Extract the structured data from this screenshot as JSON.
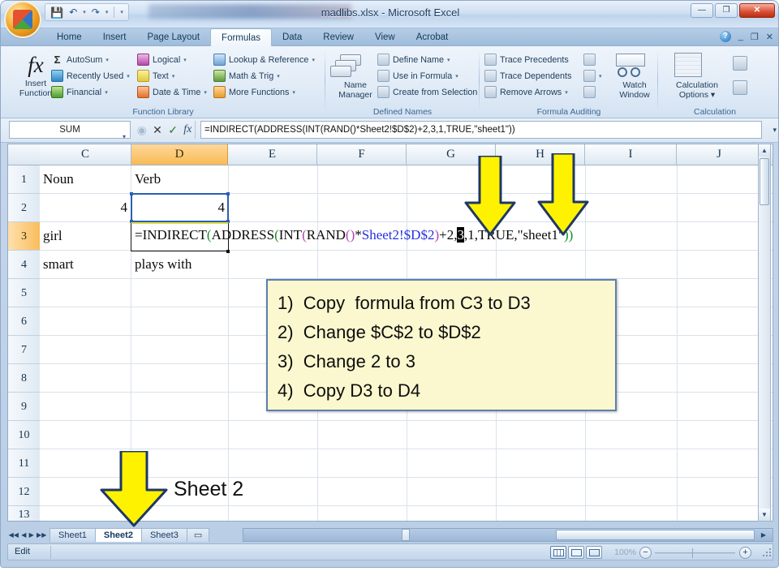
{
  "window": {
    "title": "madlibs.xlsx - Microsoft Excel",
    "minimize_label": "—",
    "restore_label": "❐",
    "close_label": "✕"
  },
  "quick_access": {
    "save_icon": "save-icon",
    "undo_icon": "undo-icon",
    "redo_icon": "redo-icon",
    "customize_icon": "chevron-down-icon"
  },
  "ribbon": {
    "tabs": [
      {
        "label": "Home",
        "active": false
      },
      {
        "label": "Insert",
        "active": false
      },
      {
        "label": "Page Layout",
        "active": false
      },
      {
        "label": "Formulas",
        "active": true
      },
      {
        "label": "Data",
        "active": false
      },
      {
        "label": "Review",
        "active": false
      },
      {
        "label": "View",
        "active": false
      },
      {
        "label": "Acrobat",
        "active": false
      }
    ],
    "help_label": "?",
    "minimize_ribbon_label": "_",
    "restore_ribbon_label": "❐",
    "close_doc_label": "✕",
    "groups": [
      {
        "title": "Function Library",
        "big_button": {
          "line1": "Insert",
          "line2": "Function",
          "icon": "fx-icon"
        },
        "items": [
          {
            "label": "AutoSum",
            "icon": "sigma-icon",
            "caret": "▾"
          },
          {
            "label": "Recently Used",
            "icon": "recently-used-icon",
            "caret": "▾"
          },
          {
            "label": "Financial",
            "icon": "financial-icon",
            "caret": "▾"
          },
          {
            "label": "Logical",
            "icon": "logical-icon",
            "caret": "▾"
          },
          {
            "label": "Text",
            "icon": "text-icon",
            "caret": "▾"
          },
          {
            "label": "Date & Time",
            "icon": "date-time-icon",
            "caret": "▾"
          },
          {
            "label": "Lookup & Reference",
            "icon": "lookup-reference-icon",
            "caret": "▾"
          },
          {
            "label": "Math & Trig",
            "icon": "math-trig-icon",
            "caret": "▾"
          },
          {
            "label": "More Functions",
            "icon": "more-functions-icon",
            "caret": "▾"
          }
        ]
      },
      {
        "title": "Defined Names",
        "big_button": {
          "line1": "Name",
          "line2": "Manager",
          "icon": "name-manager-icon"
        },
        "items": [
          {
            "label": "Define Name",
            "icon": "define-name-icon",
            "caret": "▾"
          },
          {
            "label": "Use in Formula",
            "icon": "use-in-formula-icon",
            "caret": "▾"
          },
          {
            "label": "Create from Selection",
            "icon": "create-from-selection-icon",
            "caret": ""
          }
        ]
      },
      {
        "title": "Formula Auditing",
        "big_button": {
          "line1": "Watch",
          "line2": "Window",
          "icon": "watch-window-icon"
        },
        "items": [
          {
            "label": "Trace Precedents",
            "icon": "trace-precedents-icon",
            "caret": ""
          },
          {
            "label": "Trace Dependents",
            "icon": "trace-dependents-icon",
            "caret": ""
          },
          {
            "label": "Remove Arrows",
            "icon": "remove-arrows-icon",
            "caret": "▾"
          }
        ],
        "extra_icons": [
          {
            "name": "show-formulas-icon"
          },
          {
            "name": "error-checking-icon",
            "caret": "▾"
          },
          {
            "name": "evaluate-formula-icon"
          }
        ]
      },
      {
        "title": "Calculation",
        "big_button": {
          "line1": "Calculation",
          "line2": "Options ▾",
          "icon": "calculation-options-icon"
        },
        "extra_icons": [
          {
            "name": "calculate-now-icon"
          },
          {
            "name": "calculate-sheet-icon"
          }
        ]
      }
    ]
  },
  "formula_bar": {
    "name_box_value": "SUM",
    "name_box_caret": "▾",
    "insert_function_label": "fx",
    "cancel_label": "✕",
    "enter_label": "✓",
    "dropdown_label": "◉",
    "expand_label": "▾",
    "formula": "=INDIRECT(ADDRESS(INT(RAND()*Sheet2!$D$2)+2,3,1,TRUE,\"sheet1\"))"
  },
  "grid": {
    "columns": [
      "C",
      "D",
      "E",
      "F",
      "G",
      "H",
      "I",
      "J"
    ],
    "selected_column": "D",
    "rows": [
      "1",
      "2",
      "3",
      "4",
      "5",
      "6",
      "7",
      "8",
      "9",
      "10",
      "11",
      "12",
      "13"
    ],
    "selected_row": "3",
    "cells": [
      {
        "col": "C",
        "row": "1",
        "value": "Noun",
        "align": "left"
      },
      {
        "col": "D",
        "row": "1",
        "value": "Verb",
        "align": "left"
      },
      {
        "col": "C",
        "row": "2",
        "value": "4",
        "align": "right"
      },
      {
        "col": "D",
        "row": "2",
        "value": "4",
        "align": "right"
      },
      {
        "col": "C",
        "row": "3",
        "value": "girl",
        "align": "left"
      },
      {
        "col": "C",
        "row": "4",
        "value": "smart",
        "align": "left"
      },
      {
        "col": "D",
        "row": "4",
        "value": "plays with",
        "align": "left"
      }
    ],
    "editing_cell": "D3",
    "editing_formula_tokens": [
      {
        "text": "=INDIRECT",
        "style": "plain"
      },
      {
        "text": "(",
        "style": "green"
      },
      {
        "text": "ADDRESS",
        "style": "plain"
      },
      {
        "text": "(",
        "style": "green"
      },
      {
        "text": "INT",
        "style": "plain"
      },
      {
        "text": "(",
        "style": "purple"
      },
      {
        "text": "RAND",
        "style": "plain"
      },
      {
        "text": "(",
        "style": "purple"
      },
      {
        "text": ")",
        "style": "purple"
      },
      {
        "text": "*",
        "style": "plain"
      },
      {
        "text": "Sheet2!$D$2",
        "style": "blue"
      },
      {
        "text": ")",
        "style": "purple"
      },
      {
        "text": "+2,",
        "style": "plain"
      },
      {
        "text": "3",
        "style": "selected"
      },
      {
        "text": ",1,TRUE,\"sheet1\"",
        "style": "plain"
      },
      {
        "text": ")",
        "style": "green"
      },
      {
        "text": ")",
        "style": "green"
      }
    ]
  },
  "callout": {
    "lines": [
      "1)  Copy  formula from C3 to D3",
      "2)  Change $C$2 to $D$2",
      "3)  Change 2 to 3",
      "4)  Copy D3 to D4"
    ]
  },
  "annotations": {
    "sheet2_label": "Sheet 2",
    "arrow_color": "#FFF200",
    "arrow_outline": "#1F3864"
  },
  "sheet_tabs": {
    "nav_first": "◀◀",
    "nav_prev": "◀",
    "nav_next": "▶",
    "nav_last": "▶▶",
    "tabs": [
      {
        "label": "Sheet1",
        "active": false
      },
      {
        "label": "Sheet2",
        "active": true
      },
      {
        "label": "Sheet3",
        "active": false
      }
    ],
    "new_sheet_icon": "new-sheet-icon"
  },
  "status_bar": {
    "mode": "Edit",
    "view_normal": "normal-view-icon",
    "view_page_layout": "page-layout-view-icon",
    "view_page_break": "page-break-view-icon",
    "zoom_level": "100%",
    "zoom_out_label": "−",
    "zoom_in_label": "+"
  }
}
